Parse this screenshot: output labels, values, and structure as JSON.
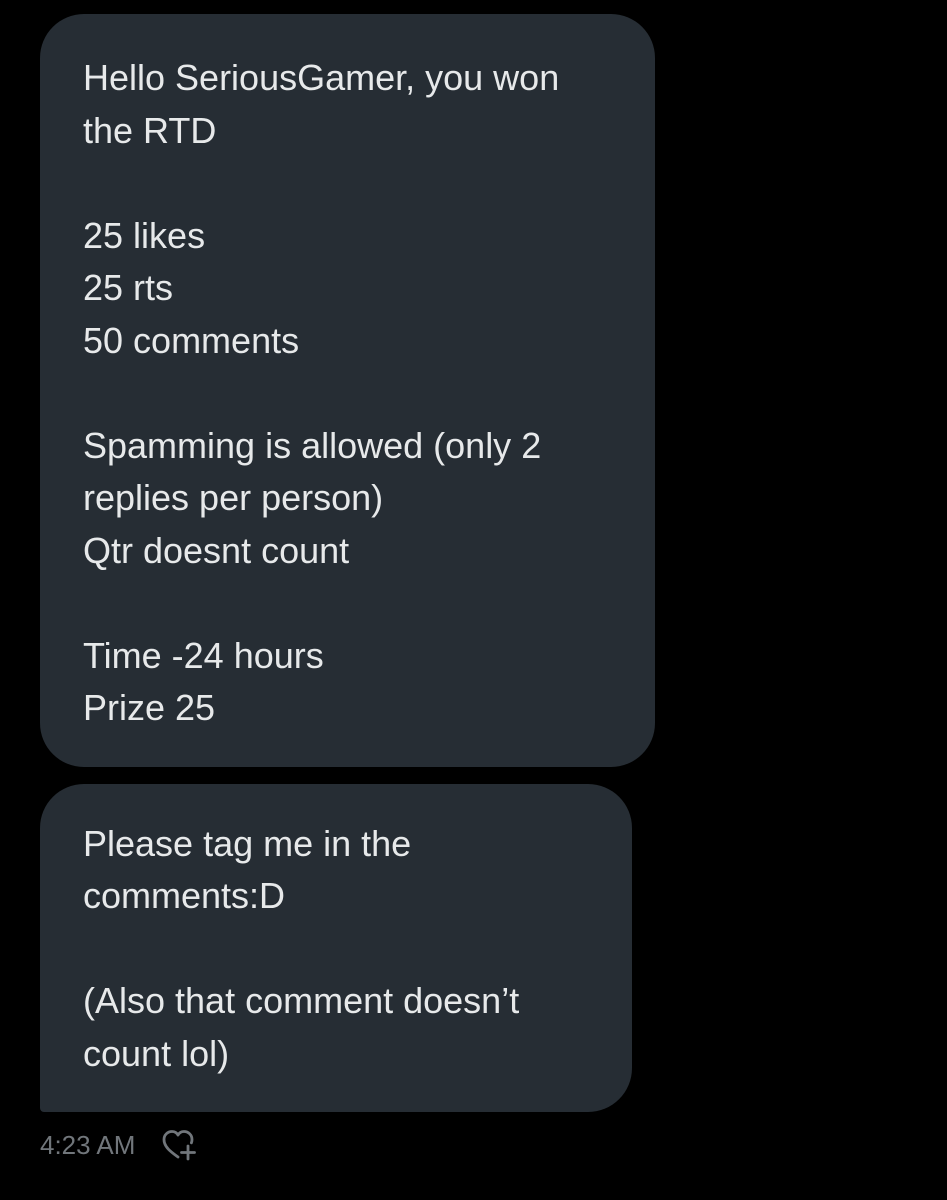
{
  "messages": [
    {
      "text": "Hello SeriousGamer, you won\nthe RTD\n\n25 likes\n25 rts\n50 comments\n\nSpamming is allowed (only 2\nreplies per person)\nQtr doesnt count\n\nTime -24 hours\nPrize 25"
    },
    {
      "text": "Please tag me in the\ncomments:D\n\n(Also that comment doesn’t\ncount lol)"
    }
  ],
  "meta": {
    "timestamp": "4:23 AM",
    "reaction_icon": "heart-plus-icon"
  },
  "colors": {
    "background": "#000000",
    "bubble": "#262d34",
    "text": "#e7e9ea",
    "muted": "#71767b"
  }
}
